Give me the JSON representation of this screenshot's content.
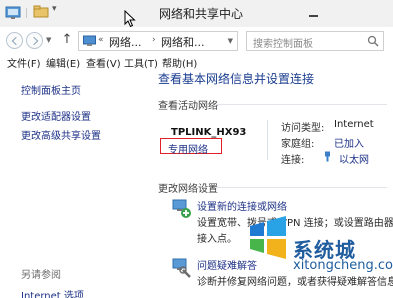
{
  "window": {
    "title": "网络和共享中心"
  },
  "address_bar": {
    "crumbs": [
      "网络...",
      "网络和..."
    ],
    "search_placeholder": "搜索控制面板"
  },
  "menu": {
    "file": "文件(F)",
    "edit": "编辑(E)",
    "view": "查看(V)",
    "tools": "工具(T)",
    "help": "帮助(H)"
  },
  "left_pane": {
    "home": "控制面板主页",
    "adapter_settings": "更改适配器设置",
    "advanced_sharing": "更改高级共享设置",
    "see_also": "另请参阅",
    "internet_options": "Internet 选项"
  },
  "main": {
    "title": "查看基本网络信息并设置连接",
    "active_networks_label": "查看活动网络",
    "network": {
      "name": "TPLINK_HX93",
      "type": "专用网络",
      "access_type_label": "访问类型:",
      "access_type_value": "Internet",
      "homegroup_label": "家庭组:",
      "homegroup_value": "已加入",
      "connections_label": "连接:",
      "connections_value": "以太网"
    },
    "change_settings_label": "更改网络设置",
    "tasks": [
      {
        "title": "设置新的连接或网络",
        "desc1": "设置宽带、拨号或 VPN 连接；或设置路由器或",
        "desc2": "接入点。"
      },
      {
        "title": "问题疑难解答",
        "desc1": "诊断并修复网络问题，或者获得疑难解答信息。"
      }
    ]
  },
  "watermark": {
    "name": "系统城",
    "url": "xitongcheng.com"
  },
  "colors": {
    "link": "#1e3287",
    "title_blue": "#1a3d8f",
    "highlight_red": "#e2202a",
    "watermark_blue": "#1f5d9e"
  }
}
